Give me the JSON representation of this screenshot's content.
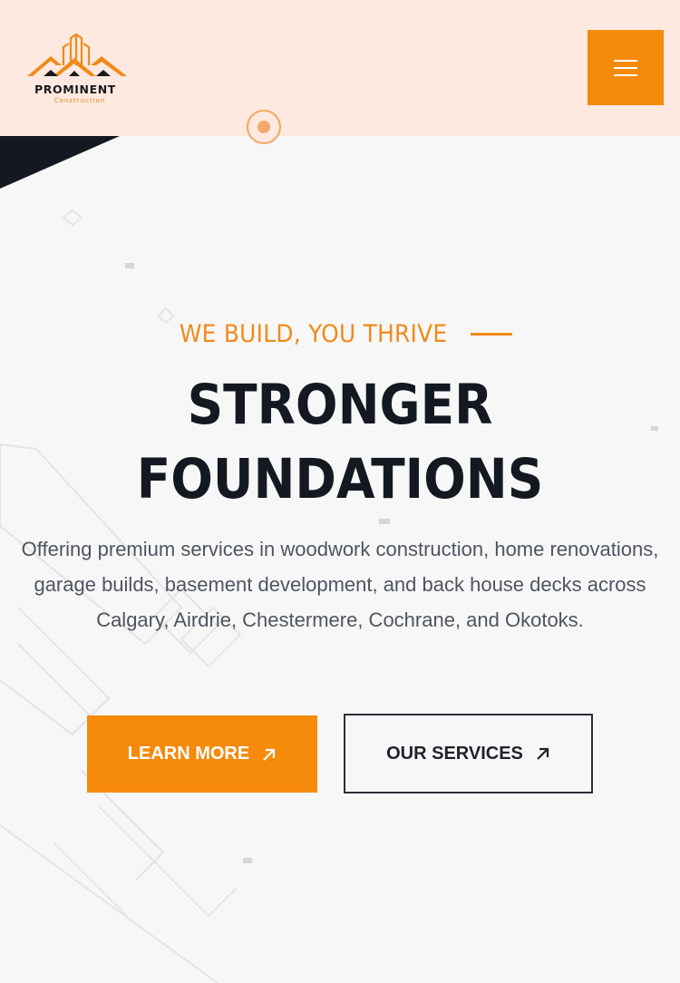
{
  "header": {
    "logo_title": "PROMINENT",
    "logo_subtitle": "Construction",
    "menu_icon": "hamburger-icon"
  },
  "hero": {
    "tagline": "WE BUILD, YOU THRIVE",
    "headline_line1": "STRONGER",
    "headline_line2": "FOUNDATIONS",
    "description": "Offering premium services in woodwork construction, home renovations, garage builds, basement development, and back house decks across Calgary, Airdrie, Chestermere, Cochrane, and Okotoks.",
    "primary_button": {
      "label": "LEARN MORE",
      "icon": "arrow-up-right-icon"
    },
    "secondary_button": {
      "label": "OUR SERVICES",
      "icon": "arrow-up-right-icon"
    }
  },
  "colors": {
    "accent": "#f58a0b",
    "header_bg": "#fde9df",
    "dark": "#141821",
    "text_muted": "#4f5560"
  }
}
